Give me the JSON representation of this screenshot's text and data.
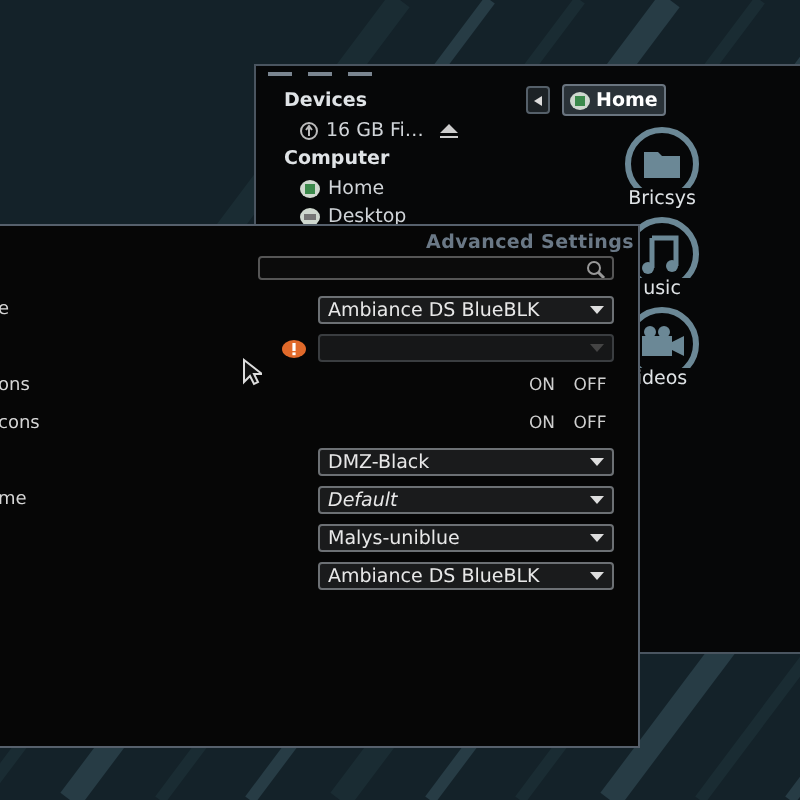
{
  "file_manager": {
    "sidebar": [
      {
        "kind": "header",
        "label": "Devices"
      },
      {
        "kind": "drive",
        "label": "16 GB Fi…",
        "eject": true
      },
      {
        "kind": "header",
        "label": "Computer"
      },
      {
        "kind": "home",
        "label": "Home"
      },
      {
        "kind": "desktop",
        "label": "Desktop"
      }
    ],
    "path": [
      {
        "label": "Home",
        "selected": true
      }
    ],
    "items": [
      {
        "kind": "folder",
        "label": "Bricsys"
      },
      {
        "kind": "music",
        "label": "usic"
      },
      {
        "kind": "video",
        "label": "ideos"
      }
    ]
  },
  "settings": {
    "title": "Advanced Settings",
    "rows": [
      {
        "kind": "dropdown",
        "label": "e",
        "value": "Ambiance DS BlueBLK"
      },
      {
        "kind": "dropdown",
        "warning": true,
        "disabled": true
      },
      {
        "kind": "switch",
        "label": "ons",
        "on": "ON",
        "off": "OFF"
      },
      {
        "kind": "switch",
        "label": "cons",
        "on": "ON",
        "off": "OFF"
      },
      {
        "kind": "dropdown",
        "value": "DMZ-Black"
      },
      {
        "kind": "dropdown",
        "label": "me",
        "value": "Default",
        "italic": true
      },
      {
        "kind": "dropdown",
        "value": "Malys-uniblue"
      },
      {
        "kind": "dropdown",
        "value": "Ambiance DS BlueBLK"
      }
    ]
  }
}
